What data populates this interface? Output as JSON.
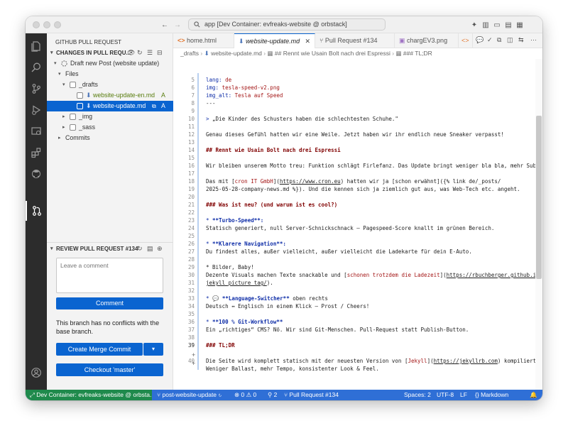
{
  "window": {
    "command_center": "app [Dev Container: evfreaks-website @ orbstack]"
  },
  "sidebar": {
    "title": "GITHUB PULL REQUEST",
    "changes_header": "CHANGES IN PULL REQU...",
    "pr_node": "Draft new Post (website update)",
    "files_label": "Files",
    "folders": [
      "_drafts",
      "_img",
      "_sass"
    ],
    "commits_label": "Commits",
    "files": [
      {
        "name": "website-update-en.md",
        "status": "A"
      },
      {
        "name": "website-update.md",
        "status": "A"
      }
    ],
    "review_header": "REVIEW PULL REQUEST #134",
    "comment_placeholder": "Leave a comment",
    "comment_button": "Comment",
    "conflict_text_1": "This branch has no conflicts with the",
    "conflict_text_2": "base branch.",
    "merge_button": "Create Merge Commit",
    "checkout_button": "Checkout 'master'"
  },
  "tabs": [
    {
      "label": "home.html",
      "icon": "html-icon"
    },
    {
      "label": "website-update.md",
      "icon": "markdown-icon",
      "active": true
    },
    {
      "label": "Pull Request #134",
      "icon": "pull-request-icon"
    },
    {
      "label": "chargEV3.png",
      "icon": "image-icon"
    }
  ],
  "breadcrumb": {
    "folder": "_drafts",
    "file": "website-update.md",
    "h2": "## Rennt wie Usain Bolt nach drei Espressi",
    "h3": "### TL;DR"
  },
  "editor": {
    "line_numbers": [
      "5",
      "6",
      "7",
      "8",
      "9",
      "10",
      "11",
      "12",
      "13",
      "14",
      "15",
      "16",
      "17",
      "18",
      "19",
      "20",
      "21",
      "22",
      "23",
      "24",
      "25",
      "26",
      "27",
      "28",
      "29",
      "30",
      "31",
      "32",
      "33",
      "34",
      "35",
      "36",
      "37",
      "38",
      "39",
      "",
      "40"
    ],
    "lines": {
      "l5k": "lang:",
      "l5v": " de",
      "l6k": "img:",
      "l6v": " tesla-speed-v2.png",
      "l7k": "img_alt:",
      "l7v": " Tesla auf Speed",
      "l8": "---",
      "l10a": "> ",
      "l10b": "„Die Kinder des Schusters haben die schlechtesten Schuhe.\"",
      "l12": "Genau dieses Gefühl hatten wir eine Weile. Jetzt haben wir ihr endlich neue Sneaker verpasst!",
      "l14": "## Rennt wie Usain Bolt nach drei Espressi",
      "l16": "Wir bleiben unserem Motto treu: Funktion schlägt Firlefanz. Das Update bringt weniger bla bla, mehr Substanz.",
      "l18a": "Das mit [",
      "l18b": "cron IT GmbH",
      "l18c": "](",
      "l18d": "https://www.cron.eu",
      "l18e": ") hatten wir ja [schon erwähnt]({% link de/_posts/",
      "l18f": "2025-05-28-company-news.md %}). Und die kennen sich ja ziemlich gut aus, was Web-Tech etc. angeht.",
      "l20": "### Was ist neu? (und warum ist es cool?)",
      "l22a": "* ",
      "l22b": "**Turbo-Speed**:",
      "l22c": "  Statisch generiert, null Server-Schnickschnack – Pagespeed-Score knallt im grünen Bereich.",
      "l25a": "* ",
      "l25b": "**Klarere Navigation**:",
      "l25c": "  Du findest alles, außer vielleicht, außer vielleicht die Ladekarte für dein E-Auto.",
      "l28": "* Bilder, Baby!",
      "l28a": "  Dezente Visuals machen Texte snackable und [",
      "l28b": "schonen trotzdem die Ladezeit",
      "l28c": "](",
      "l28d": "https://rbuchberger.github.io/",
      "l28e": "jekyll_picture_tag/",
      "l28f": ").",
      "l31a": "* 💬 ",
      "l31b": "**Language-Switcher**",
      "l31c": " oben rechts",
      "l31d": "  Deutsch ↔ Englisch in einem Klick – Prost / Cheers!",
      "l34a": "* ",
      "l34b": "**100 % Git-Workflow**",
      "l34c": "  Ein „richtiges“ CMS? Nö. Wir sind Git-Menschen. Pull-Request statt Publish-Button.",
      "l37": "### TL;DR",
      "l39a": "Die Seite wird komplett statisch mit der neuesten Version von [",
      "l39b": "Jekyll",
      "l39c": "](",
      "l39d": "https://jekyllrb.com",
      "l39e": ") kompiliert.",
      "l39f": "Weniger Ballast, mehr Tempo, konsistenter Look & Feel."
    }
  },
  "status": {
    "remote": "Dev Container: evfreaks-website @ orbsta...",
    "branch": "post-website-update",
    "problems": "⊗ 0 ⚠ 0",
    "ports": "2",
    "pr": "Pull Request #134",
    "spaces": "Spaces: 2",
    "encoding": "UTF-8",
    "eol": "LF",
    "language": "Markdown"
  },
  "colors": {
    "accent": "#0a64d0",
    "status_bar": "#2f6fd6",
    "activity_bar": "#2c2c2c"
  }
}
